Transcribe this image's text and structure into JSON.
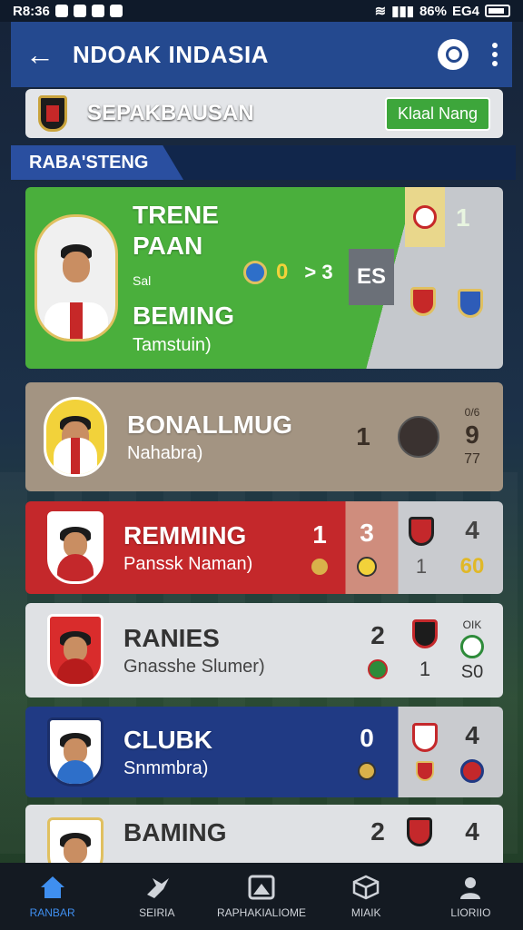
{
  "status": {
    "time": "R8:36",
    "battery": "86%",
    "signal": "EG4"
  },
  "appbar": {
    "title": "NDOAK INDASIA"
  },
  "league": {
    "title": "SEPAKBAUSAN",
    "follow_label": "Klaal Nang"
  },
  "section": {
    "title": "RABA'STENG"
  },
  "cards": [
    {
      "name": "TRENE PAAN",
      "sub_small": "Sal",
      "name2": "BEMING",
      "sub": "Tamstuin)",
      "score_a": "0",
      "score_sep": "> 3",
      "tag": "ES",
      "num": "1"
    },
    {
      "name": "BONALLMUG",
      "sub": "Nahabra)",
      "num": "1",
      "right_top": "0/6",
      "right_mid": "9",
      "right_bot": "77"
    },
    {
      "name": "REMMING",
      "sub": "Panssk Naman)",
      "num1": "1",
      "num2": "3",
      "right_top": "4",
      "right_bot": "60",
      "mid_bot": "1"
    },
    {
      "name": "RANIES",
      "sub": "Gnasshe Slumer)",
      "num": "2",
      "mid_bot": "1",
      "right_top": "OIK",
      "right_bot": "S0"
    },
    {
      "name": "CLUBK",
      "sub": "Snmmbra)",
      "num": "0",
      "right_top": "4"
    },
    {
      "name": "BAMING",
      "sub": "",
      "num": "2",
      "right_top": "4"
    }
  ],
  "nav": [
    {
      "label": "RANBAR",
      "icon": "home-icon"
    },
    {
      "label": "SEIRIA",
      "icon": "bird-icon"
    },
    {
      "label": "RAPHAKIALIOME",
      "icon": "image-icon"
    },
    {
      "label": "MIAIK",
      "icon": "box-icon"
    },
    {
      "label": "LIORIIO",
      "icon": "profile-icon"
    }
  ]
}
